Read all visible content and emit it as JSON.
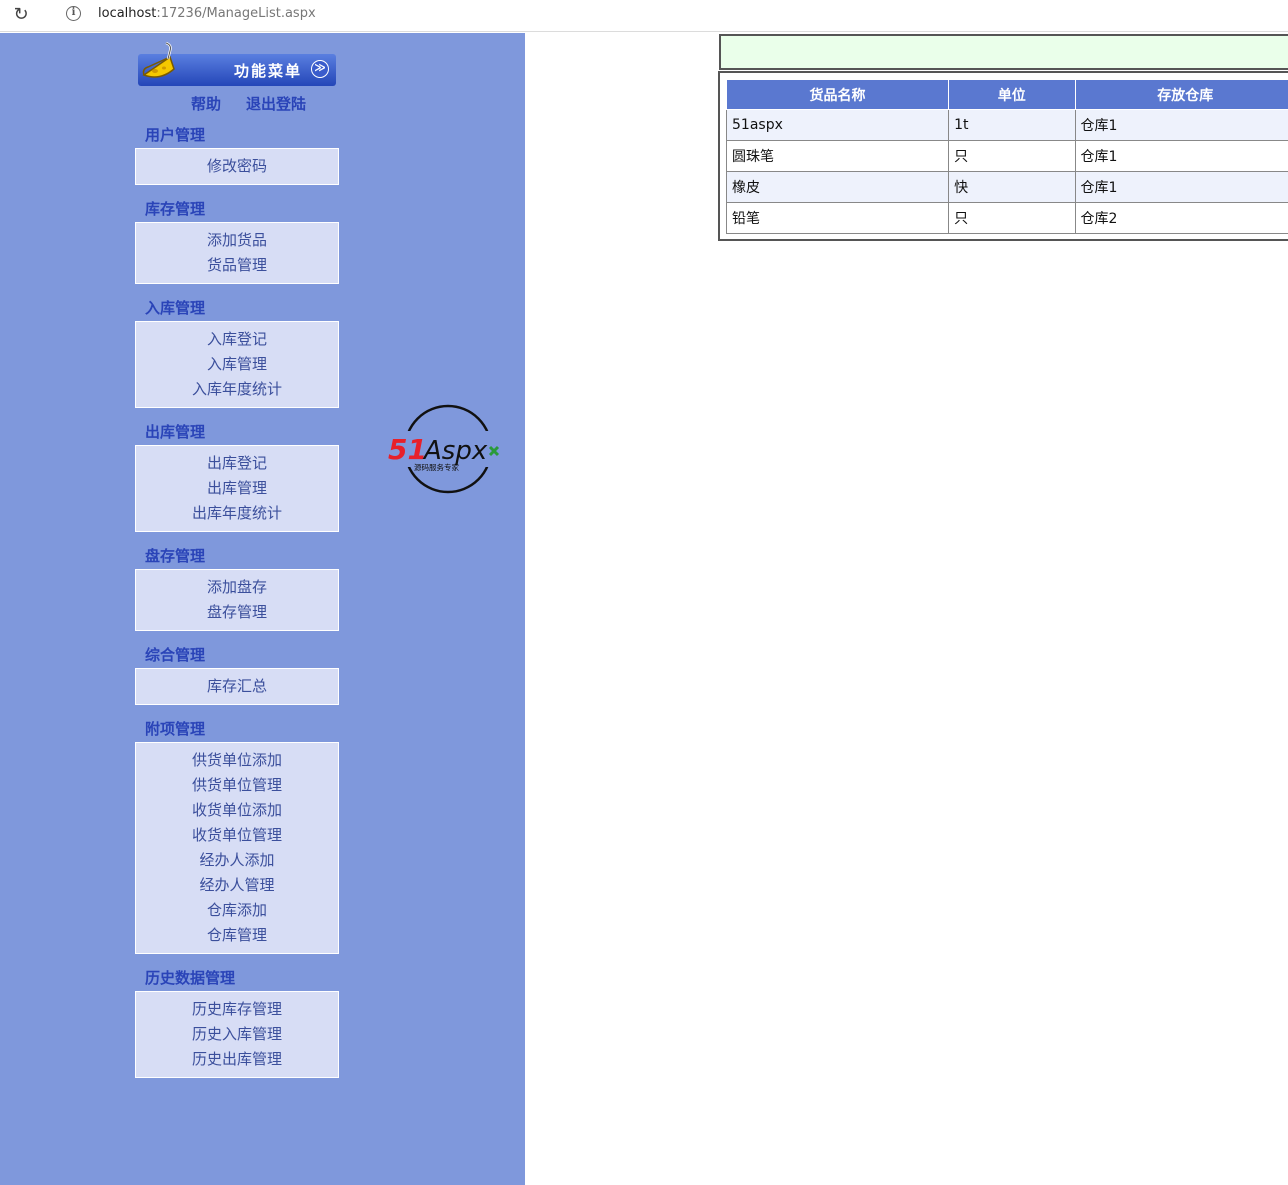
{
  "browser": {
    "url_host": "localhost",
    "url_rest": ":17236/ManageList.aspx"
  },
  "menu": {
    "title": "功能菜单",
    "help": "帮助",
    "logout": "退出登陆",
    "sections": [
      {
        "title": "用户管理",
        "items": [
          "修改密码"
        ]
      },
      {
        "title": "库存管理",
        "items": [
          "添加货品",
          "货品管理"
        ]
      },
      {
        "title": "入库管理",
        "items": [
          "入库登记",
          "入库管理",
          "入库年度统计"
        ]
      },
      {
        "title": "出库管理",
        "items": [
          "出库登记",
          "出库管理",
          "出库年度统计"
        ]
      },
      {
        "title": "盘存管理",
        "items": [
          "添加盘存",
          "盘存管理"
        ]
      },
      {
        "title": "综合管理",
        "items": [
          "库存汇总"
        ]
      },
      {
        "title": "附项管理",
        "items": [
          "供货单位添加",
          "供货单位管理",
          "收货单位添加",
          "收货单位管理",
          "经办人添加",
          "经办人管理",
          "仓库添加",
          "仓库管理"
        ]
      },
      {
        "title": "历史数据管理",
        "items": [
          "历史库存管理",
          "历史入库管理",
          "历史出库管理"
        ]
      }
    ]
  },
  "logo": {
    "brand_red": "51",
    "brand_dark": "Aspx",
    "tagline": "源码服务专家"
  },
  "grid": {
    "headers": [
      "货品名称",
      "单位",
      "存放仓库"
    ],
    "rows": [
      [
        "51aspx",
        "1t",
        "仓库1"
      ],
      [
        "圆珠笔",
        "只",
        "仓库1"
      ],
      [
        "橡皮",
        "快",
        "仓库1"
      ],
      [
        "铅笔",
        "只",
        "仓库2"
      ]
    ]
  },
  "colors": {
    "sidebar_bg": "#7f98dc",
    "section_bg": "#d7ddf5",
    "header_blue": "#5a78d0",
    "logo_red": "#e8202a",
    "logo_green": "#2a9a3a"
  }
}
